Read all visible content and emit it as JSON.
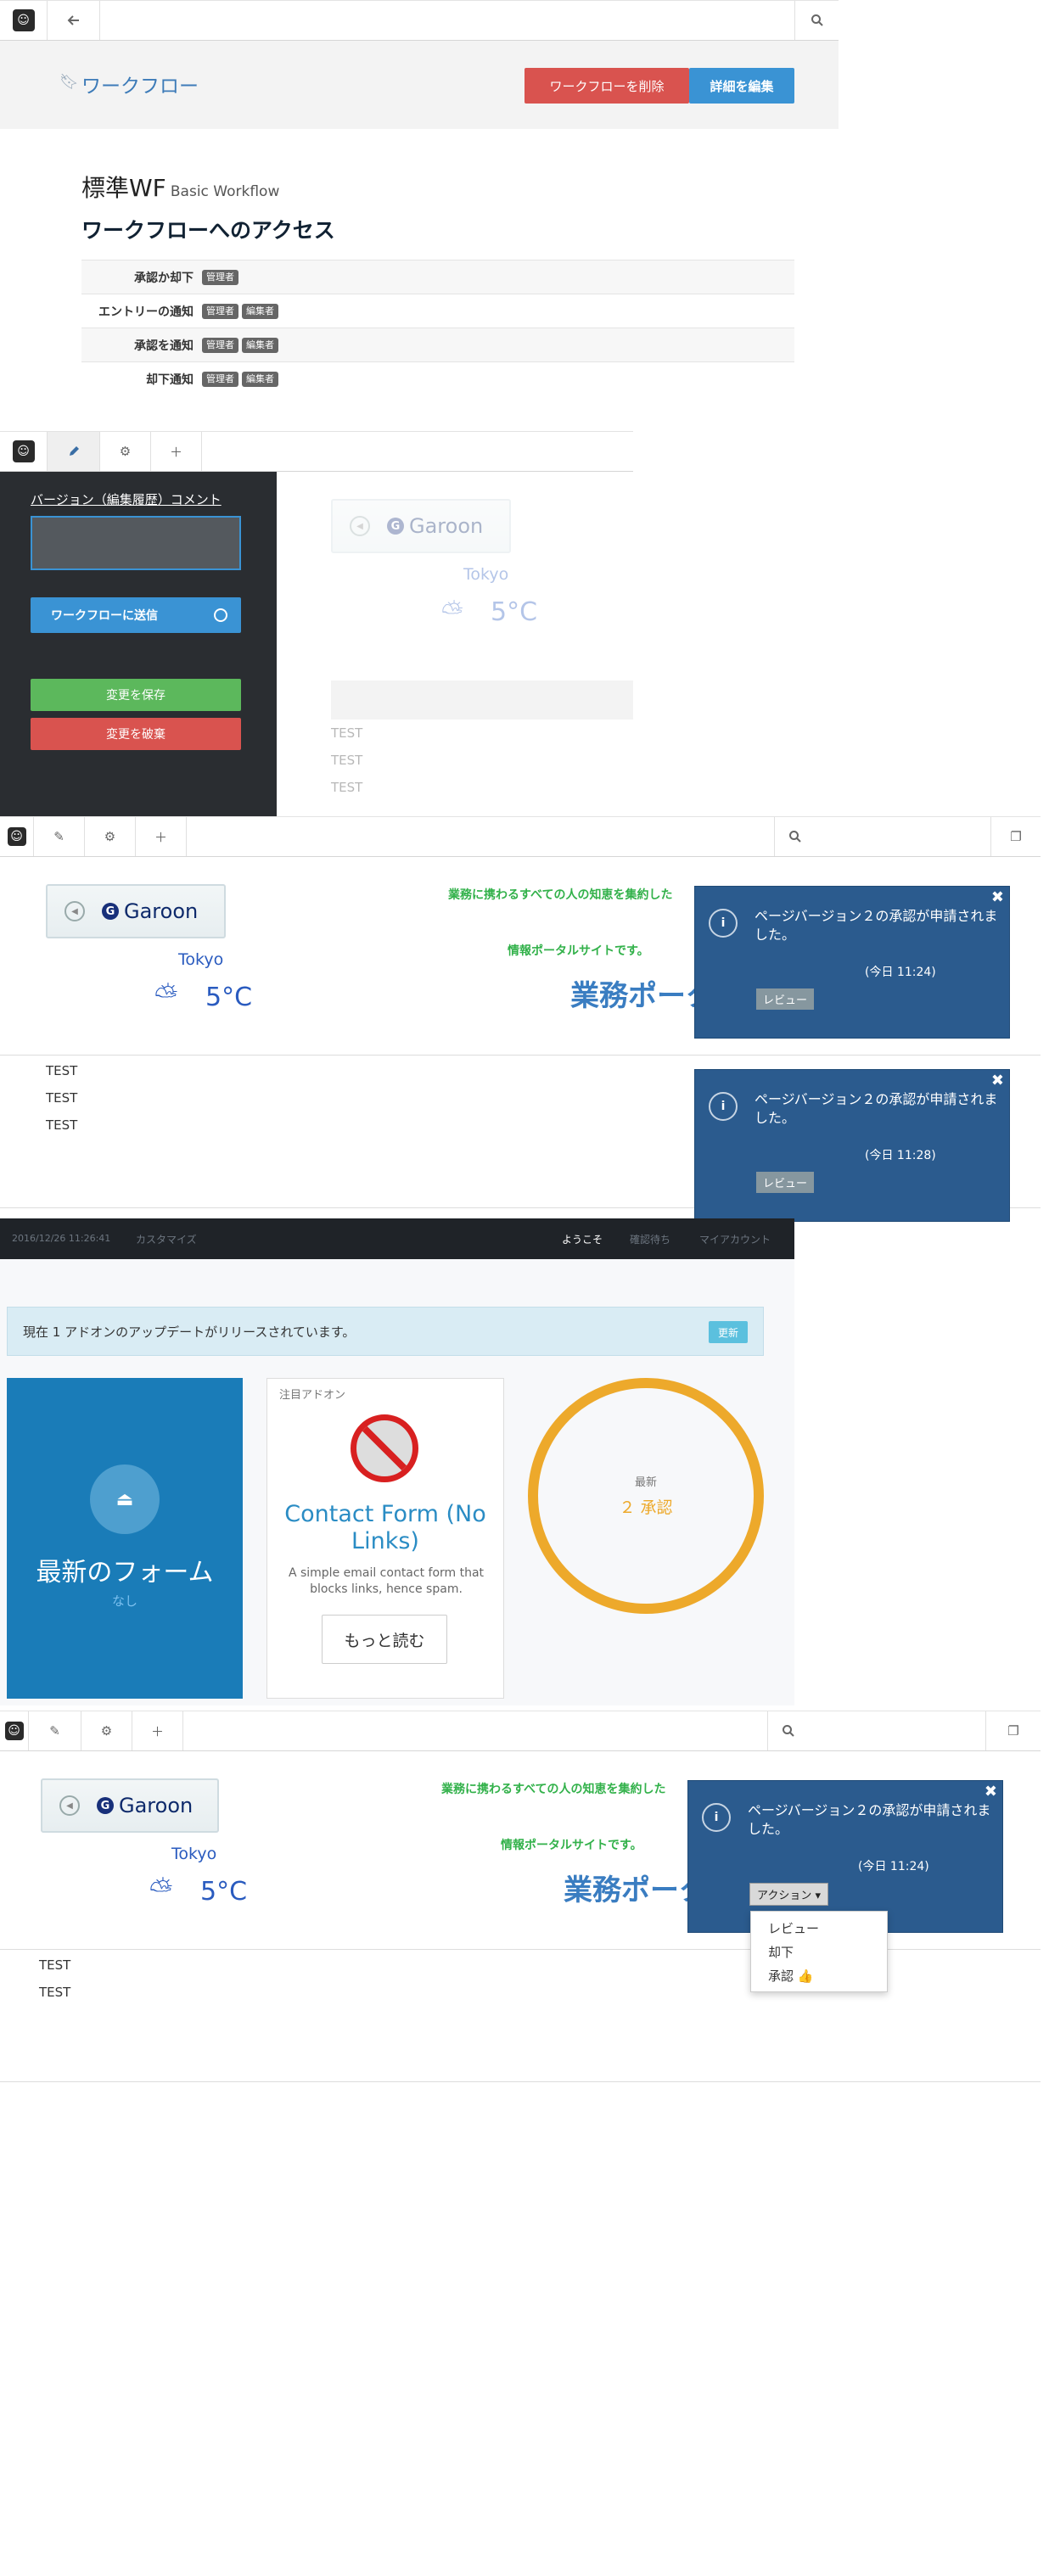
{
  "s1": {
    "header_title": "ワークフロー",
    "delete_btn": "ワークフローを削除",
    "edit_btn": "詳細を編集",
    "wf_name": "標準WF",
    "wf_sub": "Basic Workflow",
    "access_title": "ワークフローへのアクセス",
    "rows": [
      {
        "label": "承認か却下",
        "tags": [
          "管理者"
        ]
      },
      {
        "label": "エントリーの通知",
        "tags": [
          "管理者",
          "編集者"
        ]
      },
      {
        "label": "承認を通知",
        "tags": [
          "管理者",
          "編集者"
        ]
      },
      {
        "label": "却下通知",
        "tags": [
          "管理者",
          "編集者"
        ]
      }
    ]
  },
  "s2": {
    "comment_label": "バージョン（編集履歴）コメント",
    "send_btn": "ワークフローに送信",
    "save_btn": "変更を保存",
    "discard_btn": "変更を破棄",
    "garoon": "Garoon",
    "city": "Tokyo",
    "temp": "5°C",
    "tests": [
      "TEST",
      "TEST",
      "TEST"
    ]
  },
  "s3": {
    "garoon": "Garoon",
    "city": "Tokyo",
    "temp": "5°C",
    "green1": "業務に携わるすべての人の知恵を集約した",
    "green2": "情報ポータルサイトです。",
    "portal": "業務ポータル",
    "tests": [
      "TEST",
      "TEST",
      "TEST"
    ],
    "notif1": {
      "msg": "ページバージョン２の承認が申請されました。",
      "time": "(今日 11:24)",
      "btn": "レビュー"
    },
    "notif2": {
      "msg": "ページバージョン２の承認が申請されました。",
      "time": "(今日 11:28)",
      "btn": "レビュー"
    }
  },
  "s4": {
    "date": "2016/12/26 11:26:41",
    "customize": "カスタマイズ",
    "welcome": "ようこそ",
    "pending": "確認待ち",
    "myaccount": "マイアカウント",
    "update_msg": "現在 1 アドオンのアップデートがリリースされています。",
    "update_btn": "更新",
    "forms_title": "最新のフォーム",
    "forms_none": "なし",
    "featured_label": "注目アドオン",
    "addon_title": "Contact Form (No Links)",
    "addon_desc": "A simple email contact form that blocks links, hence spam.",
    "read_more": "もっと読む",
    "latest_label": "最新",
    "latest_value": "２ 承認"
  },
  "s5": {
    "garoon": "Garoon",
    "city": "Tokyo",
    "temp": "5°C",
    "green1": "業務に携わるすべての人の知恵を集約した",
    "green2": "情報ポータルサイトです。",
    "portal": "業務ポータル",
    "tests": [
      "TEST",
      "TEST"
    ],
    "notif": {
      "msg": "ページバージョン２の承認が申請されました。",
      "time": "(今日 11:24)"
    },
    "action_btn": "アクション ▾",
    "menu": [
      "レビュー",
      "却下",
      "承認 👍"
    ]
  },
  "colors": {
    "red": "#d9534f",
    "blue": "#3a93d4",
    "green": "#5cb85c",
    "dark_panel": "#2a2d31",
    "notif": "#2b5b8e",
    "orange": "#eda92b"
  }
}
